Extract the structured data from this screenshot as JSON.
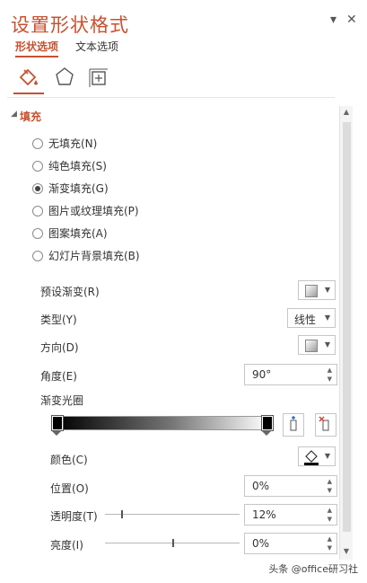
{
  "pane": {
    "title": "设置形状格式",
    "min_label": "▾",
    "close_label": "✕",
    "subtabs": [
      {
        "label": "形状选项",
        "active": true
      },
      {
        "label": "文本选项",
        "active": false
      }
    ],
    "category_icons": [
      "fill-line-icon",
      "effects-icon",
      "size-properties-icon"
    ]
  },
  "fill": {
    "section_label": "填充",
    "options": [
      {
        "label": "无填充(N)",
        "checked": false
      },
      {
        "label": "纯色填充(S)",
        "checked": false
      },
      {
        "label": "渐变填充(G)",
        "checked": true
      },
      {
        "label": "图片或纹理填充(P)",
        "checked": false
      },
      {
        "label": "图案填充(A)",
        "checked": false
      },
      {
        "label": "幻灯片背景填充(B)",
        "checked": false
      }
    ],
    "preset_label": "预设渐变(R)",
    "type_label": "类型(Y)",
    "type_value": "线性",
    "direction_label": "方向(D)",
    "angle_label": "角度(E)",
    "angle_value": "90°",
    "stops_label": "渐变光圈",
    "color_label": "颜色(C)",
    "position_label": "位置(O)",
    "position_value": "0%",
    "transparency_label": "透明度(T)",
    "transparency_value": "12%",
    "brightness_label": "亮度(I)",
    "brightness_value": "0%",
    "gradient_colors": [
      "#000000",
      "#777777",
      "#ffffff"
    ],
    "transparency_level": 0.12,
    "brightness_level": 0.5
  },
  "watermark": "头条 @office研习社",
  "accent_color": "#c8502f"
}
